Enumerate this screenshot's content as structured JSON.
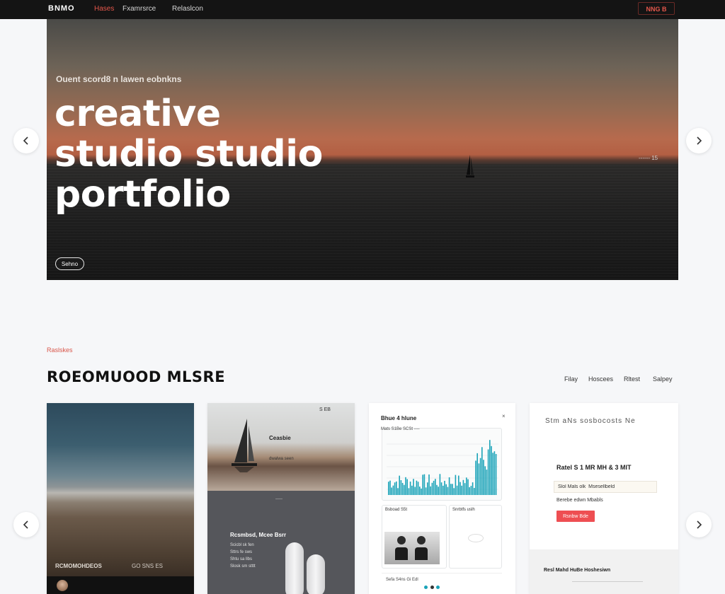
{
  "nav": {
    "brand": "BNMO",
    "links": [
      "Hases",
      "Fxamrsrce",
      "Relaslcon"
    ],
    "active_index": 0,
    "cta": "NNG B"
  },
  "hero": {
    "eyebrow": "Ouent scord8   n   lawen   eobnkns",
    "title_lines": [
      "creative",
      "studio studio",
      "portfolio"
    ],
    "button": "Sehno",
    "counter": "------   15"
  },
  "section": {
    "eyebrow": "Raslskes",
    "title": "ROEOMUOOD MLSRE",
    "filters": [
      "Filay",
      "Hoscees",
      "Rltest",
      "Salpey"
    ]
  },
  "cards": {
    "c1": {
      "caption": "RCMOMOHDEOS",
      "caption2": "GO   SNS   ES"
    },
    "c2": {
      "tag": "S  EB",
      "photo_label": "Ceasbie",
      "photo_sub": "dwalwa seen",
      "divider": "-----",
      "panel_title": "Rcsmbsd, Mcee Bsrr",
      "panel_lines": [
        "Scicbl sk fen",
        "Sttrs fe sws",
        "Shtu sa llbs",
        "Slosk sm stttt"
      ]
    },
    "c3": {
      "title": "Bhue 4 hlune",
      "close": "×",
      "chart_head": "Mats S1Be  SCSt   ----",
      "tile1_label": "Bsboad  S5t",
      "tile2_label": "Snrbtfs  uslh",
      "footer": "Sefa S4ns  Gi Edl"
    },
    "c4": {
      "sketch": "Stm aNs sosbocosts Ne",
      "headline": "Ratel S 1 MR MH & 3 MIT",
      "input_value": "Slol Mals olk  Msesellbeld",
      "note": "Berebe edwn  Mbabls",
      "cta": "Rsnbw Bde",
      "gray_title": "Resl Mahd HuBe Hoshesiwn"
    }
  },
  "colors": {
    "accent": "#e4574b",
    "nav_bg": "#141414",
    "chart": "#1aa3b8"
  },
  "icons": {
    "prev": "chevron-left-icon",
    "next": "chevron-right-icon"
  }
}
